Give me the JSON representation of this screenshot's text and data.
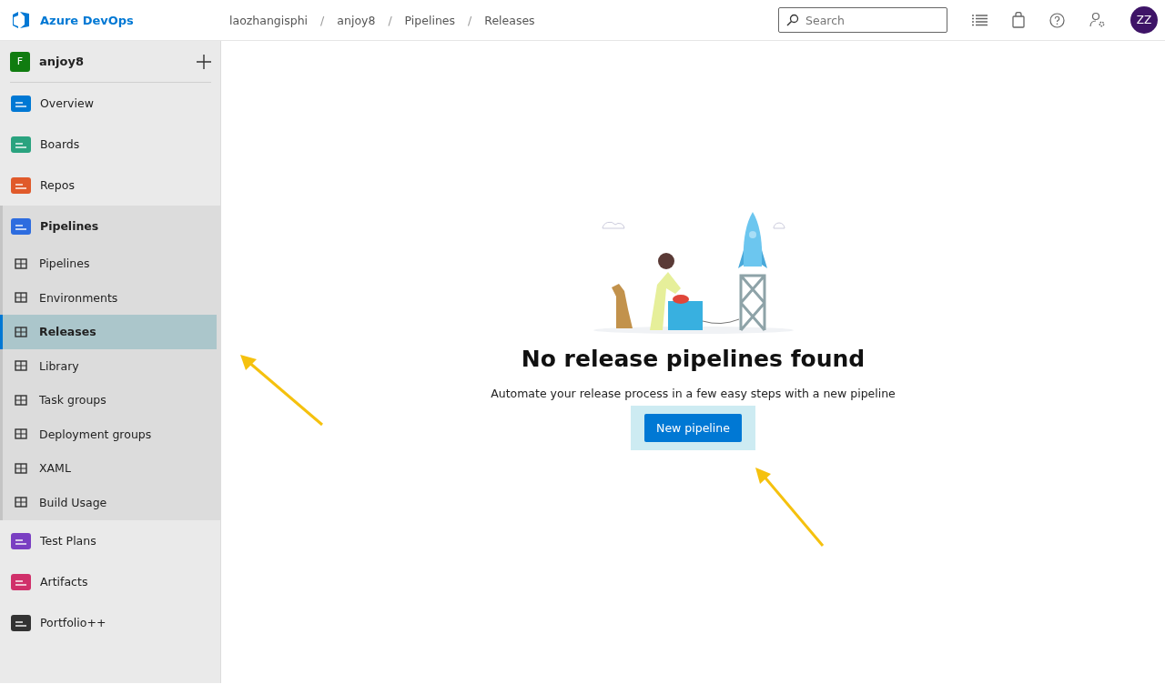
{
  "header": {
    "product": "Azure DevOps",
    "breadcrumbs": [
      "laozhangisphi",
      "anjoy8",
      "Pipelines",
      "Releases"
    ],
    "separator": "/",
    "search": {
      "placeholder": "Search"
    },
    "avatar": "ZZ"
  },
  "sidebar": {
    "project": {
      "initial": "F",
      "name": "anjoy8"
    },
    "items": [
      {
        "label": "Overview",
        "selected": false,
        "expanded": false
      },
      {
        "label": "Boards",
        "selected": false,
        "expanded": false
      },
      {
        "label": "Repos",
        "selected": false,
        "expanded": false
      },
      {
        "label": "Pipelines",
        "selected": false,
        "expanded": true,
        "children": [
          {
            "label": "Pipelines",
            "selected": false
          },
          {
            "label": "Environments",
            "selected": false
          },
          {
            "label": "Releases",
            "selected": true
          },
          {
            "label": "Library",
            "selected": false
          },
          {
            "label": "Task groups",
            "selected": false
          },
          {
            "label": "Deployment groups",
            "selected": false
          },
          {
            "label": "XAML",
            "selected": false
          },
          {
            "label": "Build Usage",
            "selected": false
          }
        ]
      },
      {
        "label": "Test Plans",
        "selected": false,
        "expanded": false
      },
      {
        "label": "Artifacts",
        "selected": false,
        "expanded": false
      },
      {
        "label": "Portfolio++",
        "selected": false,
        "expanded": false
      }
    ]
  },
  "main": {
    "title": "No release pipelines found",
    "description": "Automate your release process in a few easy steps with a new pipeline",
    "button": "New pipeline"
  }
}
